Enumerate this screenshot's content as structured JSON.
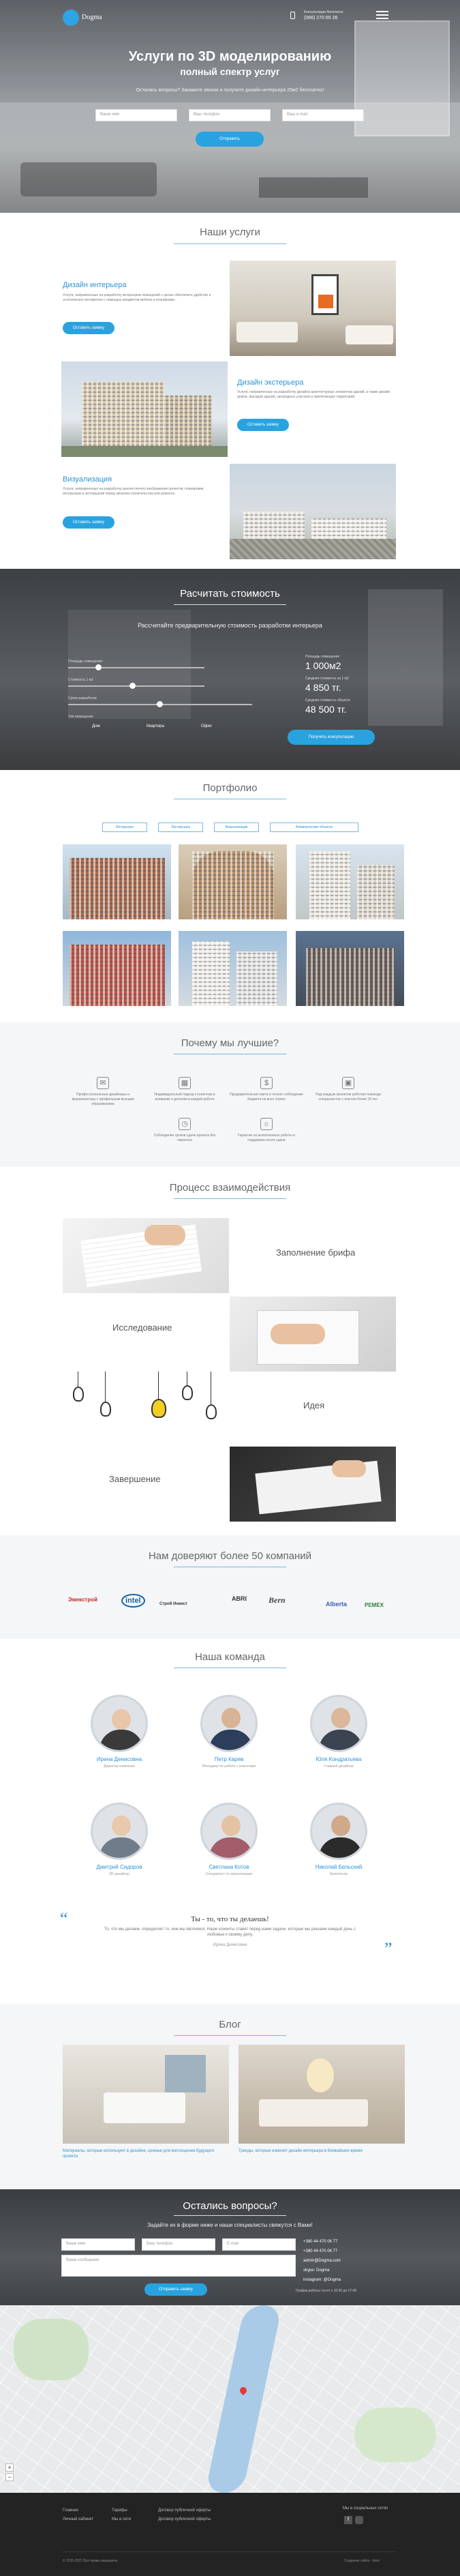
{
  "header": {
    "brand": "Dogma",
    "contact_caption": "Консультации бесплатно",
    "phone": "(066) 270 65 26",
    "menu_icon": "hamburger-icon"
  },
  "hero": {
    "title_line1": "Услуги по 3D моделированию",
    "title_line2": "полный спектр услуг",
    "question": "Остались вопросы? Закажите звонок и получите дизайн-интерьера 25м2 бесплатно!",
    "name_placeholder": "Ваше имя",
    "phone_placeholder": "Ваш телефон",
    "email_placeholder": "Ваш e-mail",
    "submit": "Отправить"
  },
  "services": {
    "title": "Наши услуги",
    "items": [
      {
        "name": "Дизайн интерьера",
        "text": "Услуги, направленные на разработку интерьеров помещений с целью обеспечить удобство и эстетическое восприятие с помощью предметов мебели и планировки.",
        "button": "Оставить заявку"
      },
      {
        "name": "Дизайн экстерьера",
        "text": "Услуги, направленные на разработку дизайна архитектурных элементов зданий, а также дизайн домов, фасадов зданий, загородных участков и прилегающих территорий.",
        "button": "Оставить заявку"
      },
      {
        "name": "Визуализация",
        "text": "Услуги, направленные на разработку реалистичного изображения проектов, планировки, интерьеров и экстерьеров перед началом строительства или ремонта.",
        "button": "Оставить заявку"
      }
    ]
  },
  "calculator": {
    "title": "Расчитать стоимость",
    "subtitle": "Рассчитайте предварительную стоимость разработки интерьера",
    "field1": "Площадь помещения",
    "field2": "Стоимость 1 м2",
    "field3": "Сроки разработки",
    "field4": "Тип помещения",
    "option_a": "Дом",
    "option_b": "Квартира",
    "option_c": "Офис",
    "area_label": "Площадь помещения",
    "area_value": "1 000м2",
    "price_label": "Средняя стоимость за 1 м2",
    "price_value": "4 850 тг.",
    "total_label": "Средняя стоимость объекта",
    "total_value": "48 500 тг.",
    "button": "Получить консультацию"
  },
  "portfolio": {
    "title": "Портфолио",
    "tabs": [
      "Интерьеры",
      "Экстерьеры",
      "Визуализация",
      "Коммерческие объекты"
    ]
  },
  "why": {
    "title": "Почему мы лучшие?",
    "items": [
      {
        "icon": "chat-icon",
        "text": "Профессиональные дизайнеры и визуализаторы с профильным высшим образованием"
      },
      {
        "icon": "calendar-icon",
        "text": "Индивидуальный подход к клиентам и внимание к деталям в каждой работе"
      },
      {
        "icon": "money-icon",
        "text": "Предварительная смета и точное соблюдение бюджета на всех этапах"
      },
      {
        "icon": "briefcase-icon",
        "text": "Над каждым проектом работает команда специалистов с опытом более 10 лет"
      },
      {
        "icon": "clock-icon",
        "text": "Соблюдение сроков сдачи проекта без переноса"
      },
      {
        "icon": "sun-icon",
        "text": "Гарантия на выполненные работы и поддержка после сдачи"
      }
    ]
  },
  "process": {
    "title": "Процесс взаимодействия",
    "steps": [
      "Заполнение брифа",
      "Исследование",
      "Идея",
      "Завершение"
    ]
  },
  "clients": {
    "title": "Нам доверяют более 50 компаний",
    "logos": [
      "Эмекстрой",
      "intel",
      "Строй Инвест",
      "ABRI",
      "Bern",
      "Alberta",
      "PEMEX"
    ]
  },
  "team": {
    "title": "Наша команда",
    "members": [
      {
        "name": "Ирина Денисовна",
        "role": "Директор компании"
      },
      {
        "name": "Петр Карев",
        "role": "Менеджер по работе с клиентами"
      },
      {
        "name": "Юля Кондратьева",
        "role": "Главный дизайнер"
      },
      {
        "name": "Дмитрий Сидоров",
        "role": "3D дизайнер"
      },
      {
        "name": "Светлана Котов",
        "role": "Специалист по визуализации"
      },
      {
        "name": "Николай Бельский",
        "role": "Архитектор"
      }
    ],
    "quote_title": "Ты - то, что ты делаешь!",
    "quote_text": "То, что мы делаем, определяет то, кем мы являемся. Наши клиенты ставят перед нами задачи, которые мы решаем каждый день с любовью к своему делу.",
    "quote_author": "Ирина Денисовна"
  },
  "blog": {
    "title": "Блог",
    "posts": [
      "Материалы, которые используют в дизайне, ценные для воплощения будущего проекта",
      "Тренды, которые изменят дизайн интерьера в ближайшее время"
    ]
  },
  "contact": {
    "title": "Остались вопросы?",
    "subtitle": "Задайте их в форме ниже и наши специалисты свяжутся с Вами!",
    "name_placeholder": "Ваше имя",
    "phone_placeholder": "Ваш телефон",
    "email_placeholder": "E-mail",
    "message_placeholder": "Ваше сообщение",
    "button": "Отправить заявку",
    "phone1": "+380 44 470 06 77",
    "phone2": "+380 44 470 06 77",
    "email": "admin@Dogma.com",
    "skype": "skype: Dogma",
    "instagram": "instagram: @Dogma",
    "hours": "График работы: пн-пт с 10:00 до 17:00"
  },
  "footer": {
    "col1": [
      "Главная",
      "Личный кабинет"
    ],
    "col2": [
      "Тарифы",
      "Мы в сети"
    ],
    "col3": [
      "Договор публичной оферты",
      "Договор публичной оферты"
    ],
    "social_caption": "Мы в социальных сетях",
    "copyright": "© 2015-2021 Все права защищены",
    "credit": "Создание сайта - lotos"
  }
}
